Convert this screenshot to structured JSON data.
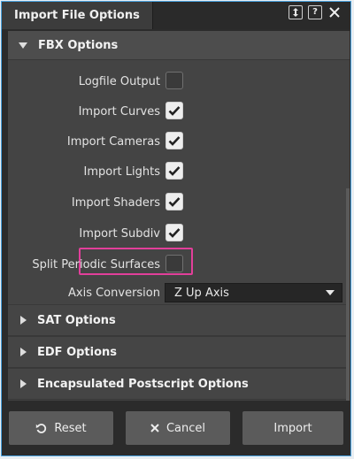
{
  "window": {
    "title": "Import File Options",
    "buttons": {
      "float_icon": "float-panel-icon",
      "help_label": "?",
      "close_icon": "close-icon"
    }
  },
  "sections": {
    "fbx": {
      "title": "FBX Options",
      "expanded": true
    },
    "sat": {
      "title": "SAT Options",
      "expanded": false
    },
    "edf": {
      "title": "EDF Options",
      "expanded": false
    },
    "eps": {
      "title": "Encapsulated Postscript Options",
      "expanded": false
    }
  },
  "fbx_options": [
    {
      "label": "Logfile Output",
      "checked": false
    },
    {
      "label": "Import Curves",
      "checked": true
    },
    {
      "label": "Import Cameras",
      "checked": true
    },
    {
      "label": "Import Lights",
      "checked": true
    },
    {
      "label": "Import Shaders",
      "checked": true
    },
    {
      "label": "Import Subdiv",
      "checked": true,
      "highlighted": true
    },
    {
      "label": "Split Periodic Surfaces",
      "checked": false
    }
  ],
  "axis_conversion": {
    "label": "Axis Conversion",
    "value": "Z Up Axis"
  },
  "footer": {
    "reset_label": "Reset",
    "cancel_label": "Cancel",
    "import_label": "Import"
  },
  "colors": {
    "highlight": "#e23f9a",
    "window_border": "#4aa3e0"
  }
}
